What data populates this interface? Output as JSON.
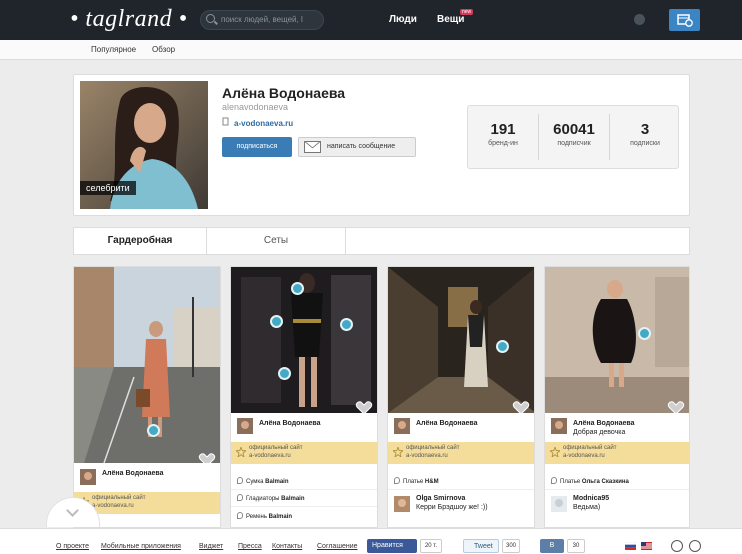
{
  "app": {
    "logo": "• taglrand •",
    "search_placeholder": "поиск людей, вещей, l",
    "nav": {
      "people": "Люди",
      "things": "Вещи",
      "things_badge": "new"
    }
  },
  "subnav": {
    "popular": "Популярное",
    "overview": "Обзор"
  },
  "profile": {
    "name": "Алёна Водонаева",
    "username": "alenavodonaeva",
    "site": "a-vodonaeva.ru",
    "photo_tag": "селебрити",
    "subscribe_label": "подписаться",
    "message_label": "написать сообщение",
    "stats": [
      {
        "num": "191",
        "label": "бренд-ин"
      },
      {
        "num": "60041",
        "label": "подписчик"
      },
      {
        "num": "3",
        "label": "подписки"
      }
    ]
  },
  "tabs": {
    "wardrobe": "Гардеробная",
    "sets": "Сеты"
  },
  "cards": [
    {
      "user": "Алёна Водонаева",
      "caption": "",
      "badge_title": "официальный сайт",
      "badge_site": "a-vodonaeva.ru",
      "items": []
    },
    {
      "user": "Алёна Водонаева",
      "caption": "",
      "badge_title": "официальный сайт",
      "badge_site": "a-vodonaeva.ru",
      "items": [
        {
          "label": "Сумка",
          "brand": "Balmain"
        },
        {
          "label": "Гладиаторы",
          "brand": "Balmain"
        },
        {
          "label": "Ремень",
          "brand": "Balmain"
        }
      ]
    },
    {
      "user": "Алёна Водонаева",
      "caption": "",
      "badge_title": "официальный сайт",
      "badge_site": "a-vodonaeva.ru",
      "items": [
        {
          "label": "Платье",
          "brand": "H&M"
        }
      ],
      "comment": {
        "user": "Olga Smirnova",
        "text": "Керри Брэдшоу же! :))"
      }
    },
    {
      "user": "Алёна Водонаева",
      "caption": "Добрая девочка",
      "badge_title": "официальный сайт",
      "badge_site": "a-vodonaeva.ru",
      "items": [
        {
          "label": "Платье",
          "brand": "Ольга Сказкина"
        }
      ],
      "comment": {
        "user": "Modnica95",
        "text": "Ведьма)"
      }
    }
  ],
  "footer": {
    "links": [
      "О проекте",
      "Мобильные приложения",
      "Виджет",
      "Пресса",
      "Контакты",
      "Соглашение"
    ],
    "fb_label": "Нравится",
    "fb_count": "20 т.",
    "tweet_label": "Tweet",
    "tweet_count": "300",
    "vk_label": "В",
    "vk_count": "30"
  },
  "colors": {
    "topbar": "#1f252b",
    "accent": "#3a7cb5",
    "pin": "#43a9c4",
    "official": "#f4dd9a"
  }
}
